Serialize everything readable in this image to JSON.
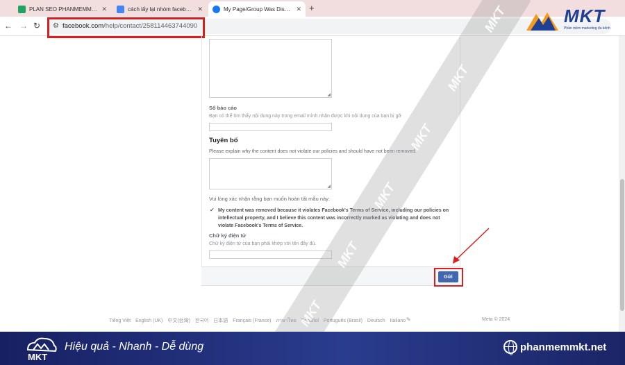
{
  "browser": {
    "tabs": [
      {
        "title": "PLAN SEO PHANMEMMKT.NET",
        "favicon_color": "#1fa463",
        "active": false
      },
      {
        "title": "cách lấy lại nhóm facebook bị v",
        "favicon_color": "#4285f4",
        "active": false
      },
      {
        "title": "My Page/Group Was Disabled |",
        "favicon_color": "#1877f2",
        "active": true
      }
    ],
    "new_tab_icon": "+",
    "url_host": "facebook.com",
    "url_path": "/help/contact/258114463744090",
    "back_icon": "←",
    "forward_icon": "→",
    "reload_icon": "↻"
  },
  "form": {
    "report_number_label": "Số báo cáo",
    "report_number_hint": "Bạn có thể tìm thấy nội dung này trong email mình nhận được khi nội dung của bạn bị gỡ",
    "statement_heading": "Tuyên bố",
    "statement_hint": "Please explain why the content does not violate our policies and should have not been removed.",
    "confirm_prompt": "Vui lòng xác nhận rằng bạn muốn hoàn tất mẫu này:",
    "confirm_checked": true,
    "acknowledgement": "My content was removed because it violates Facebook's Terms of Service, including our policies on intellectual property, and I believe this content was incorrectly marked as violating and does not violate Facebook's Terms of Service.",
    "signature_label": "Chữ ký điện tử",
    "signature_hint": "Chữ ký điện tử của bạn phải khớp với tên đầy đủ.",
    "submit_label": "Gửi"
  },
  "footer": {
    "languages": [
      "Tiếng Việt",
      "English (UK)",
      "中文(台灣)",
      "한국어",
      "日本語",
      "Français (France)",
      "ภาษาไทย",
      "Español",
      "Português (Brasil)",
      "Deutsch",
      "Italiano"
    ],
    "copyright": "Meta © 2024"
  },
  "watermark": {
    "text": "MKT"
  },
  "logo": {
    "name": "MKT",
    "tagline": "Phần mềm marketing đa kênh"
  },
  "banner": {
    "logo_text": "MKT",
    "slogan": "Hiệu quả - Nhanh - Dễ dùng",
    "website": "phanmemmkt.net"
  },
  "colors": {
    "accent": "#4267b2",
    "highlight": "#d81e1e",
    "banner": "#1e2a6b"
  }
}
